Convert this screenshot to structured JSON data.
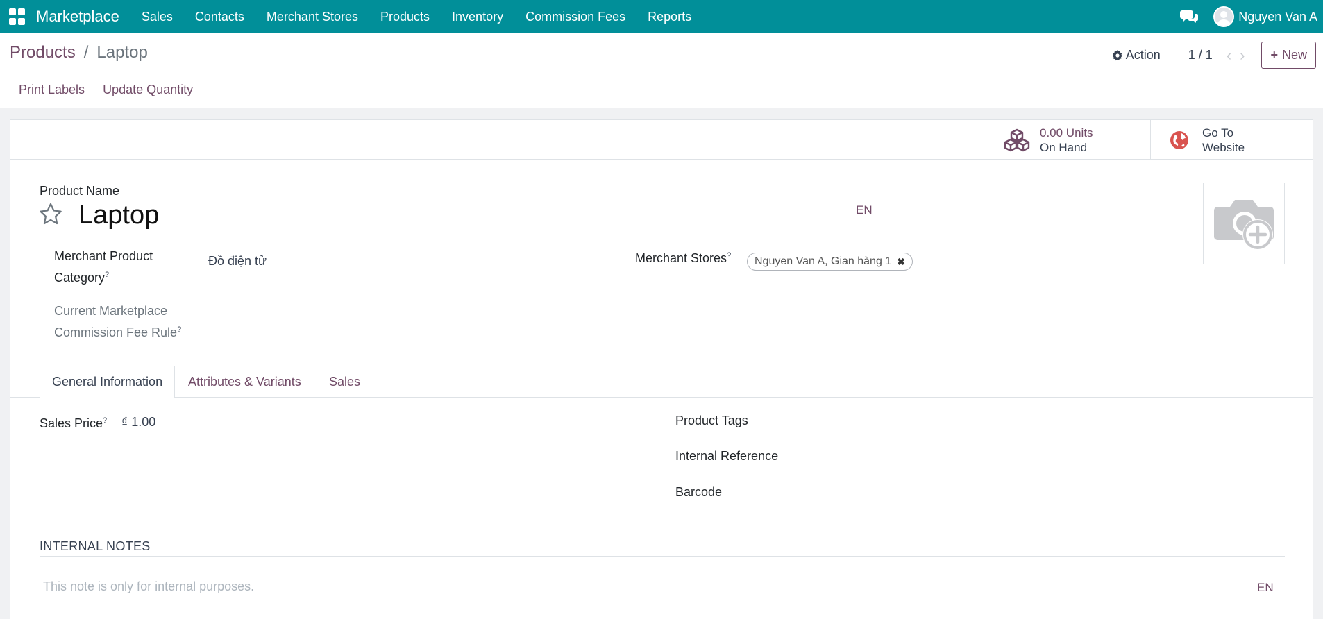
{
  "navbar": {
    "app_name": "Marketplace",
    "menu": [
      "Sales",
      "Contacts",
      "Merchant Stores",
      "Products",
      "Inventory",
      "Commission Fees",
      "Reports"
    ],
    "user_name": "Nguyen Van A",
    "color": "#018f99"
  },
  "control_panel": {
    "breadcrumb_parent": "Products",
    "breadcrumb_separator": "/",
    "breadcrumb_current": "Laptop",
    "action_label": "Action",
    "pager": "1 / 1",
    "new_label": "New"
  },
  "statusbar": {
    "print_labels": "Print Labels",
    "update_quantity": "Update Quantity"
  },
  "smart_buttons": {
    "units_value": "0.00 Units",
    "units_label": "On Hand",
    "website_line1": "Go To",
    "website_line2": "Website"
  },
  "form": {
    "product_name_label": "Product Name",
    "product_name": "Laptop",
    "lang": "EN",
    "merchant_category_label_1": "Merchant Product",
    "merchant_category_label_2": "Category",
    "merchant_category_value": "Đồ điện tử",
    "commission_label_1": "Current Marketplace",
    "commission_label_2": "Commission Fee Rule",
    "merchant_stores_label": "Merchant Stores",
    "merchant_store_tag": "Nguyen Van A, Gian hàng 1",
    "help_mark": "?"
  },
  "tabs": [
    "General Information",
    "Attributes & Variants",
    "Sales"
  ],
  "general": {
    "sales_price_label": "Sales Price",
    "sales_price_value": "₫ 1.00",
    "product_tags_label": "Product Tags",
    "internal_ref_label": "Internal Reference",
    "barcode_label": "Barcode",
    "notes_title": "INTERNAL NOTES",
    "notes_placeholder": "This note is only for internal purposes.",
    "notes_lang": "EN"
  },
  "colors": {
    "accent": "#714b67",
    "stat_icon_purple": "#714b67",
    "globe_red": "#d9534f"
  }
}
